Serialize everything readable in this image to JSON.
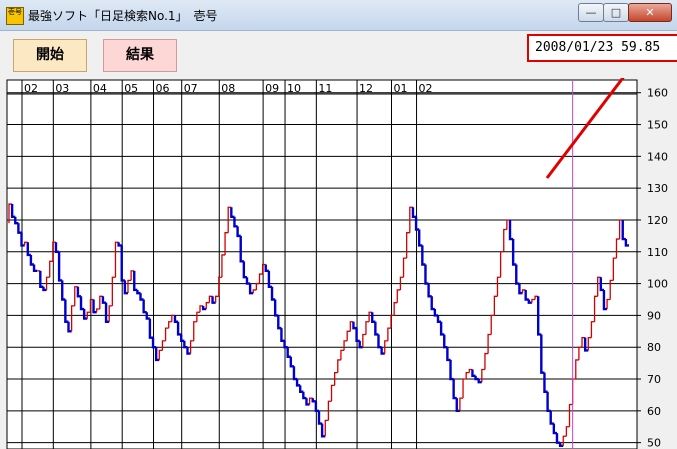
{
  "window": {
    "title": "最強ソフト「日足検索No.1」　壱号",
    "icon_label": "壱号",
    "controls": {
      "minimize": "—",
      "maximize": "□",
      "close": "✕"
    }
  },
  "toolbar": {
    "start_label": "開始",
    "result_label": "結果"
  },
  "readout": {
    "text": "2008/01/23 59.85"
  },
  "colors": {
    "up": "#d40000",
    "down": "#0000cc",
    "cursor": "#cc44cc",
    "grid": "#000000",
    "annotation": "#e00000"
  },
  "chart_data": {
    "type": "line",
    "x_tick_labels": [
      "02",
      "03",
      "04",
      "05",
      "06",
      "07",
      "08",
      "09",
      "10",
      "11",
      "12",
      "01",
      "02"
    ],
    "y_ticks": [
      160,
      150,
      140,
      130,
      120,
      110,
      100,
      90,
      80,
      70,
      60,
      50
    ],
    "ylim": [
      48,
      164
    ],
    "cursor_date": "2008/01/23",
    "cursor_value": 59.85,
    "series": [
      {
        "values": [
          119,
          125,
          121,
          119,
          116,
          112,
          113,
          109,
          106,
          104,
          104,
          99,
          98,
          102,
          107,
          113,
          110,
          101,
          95,
          88,
          85,
          93,
          99,
          96,
          92,
          89,
          91,
          95,
          91,
          92,
          96,
          94,
          88,
          93,
          102,
          113,
          112,
          101,
          97,
          101,
          104,
          98,
          97,
          95,
          91,
          89,
          83,
          80,
          76,
          79,
          82,
          86,
          88,
          90,
          88,
          84,
          82,
          80,
          78,
          82,
          88,
          91,
          93,
          92,
          94,
          96,
          94,
          96,
          102,
          109,
          116,
          124,
          121,
          118,
          115,
          107,
          102,
          100,
          97,
          98,
          100,
          103,
          106,
          104,
          99,
          95,
          90,
          86,
          82,
          80,
          77,
          74,
          70,
          68,
          66,
          64,
          62,
          64,
          63,
          60,
          56,
          52,
          57,
          63,
          68,
          72,
          76,
          79,
          82,
          85,
          88,
          86,
          82,
          80,
          84,
          88,
          91,
          88,
          84,
          80,
          78,
          82,
          86,
          90,
          94,
          98,
          102,
          108,
          116,
          124,
          121,
          117,
          112,
          106,
          100,
          96,
          92,
          90,
          88,
          84,
          80,
          76,
          70,
          64,
          60,
          64,
          70,
          72,
          73,
          71,
          70,
          69,
          73,
          78,
          84,
          90,
          96,
          102,
          110,
          117,
          120,
          114,
          106,
          100,
          97,
          98,
          95,
          94,
          95,
          96,
          84,
          72,
          66,
          60,
          56,
          53,
          50,
          49,
          52,
          55,
          62,
          70,
          76,
          80,
          83,
          79,
          83,
          88,
          96,
          102,
          98,
          92,
          95,
          101,
          108,
          114,
          120,
          114,
          112
        ]
      }
    ]
  }
}
